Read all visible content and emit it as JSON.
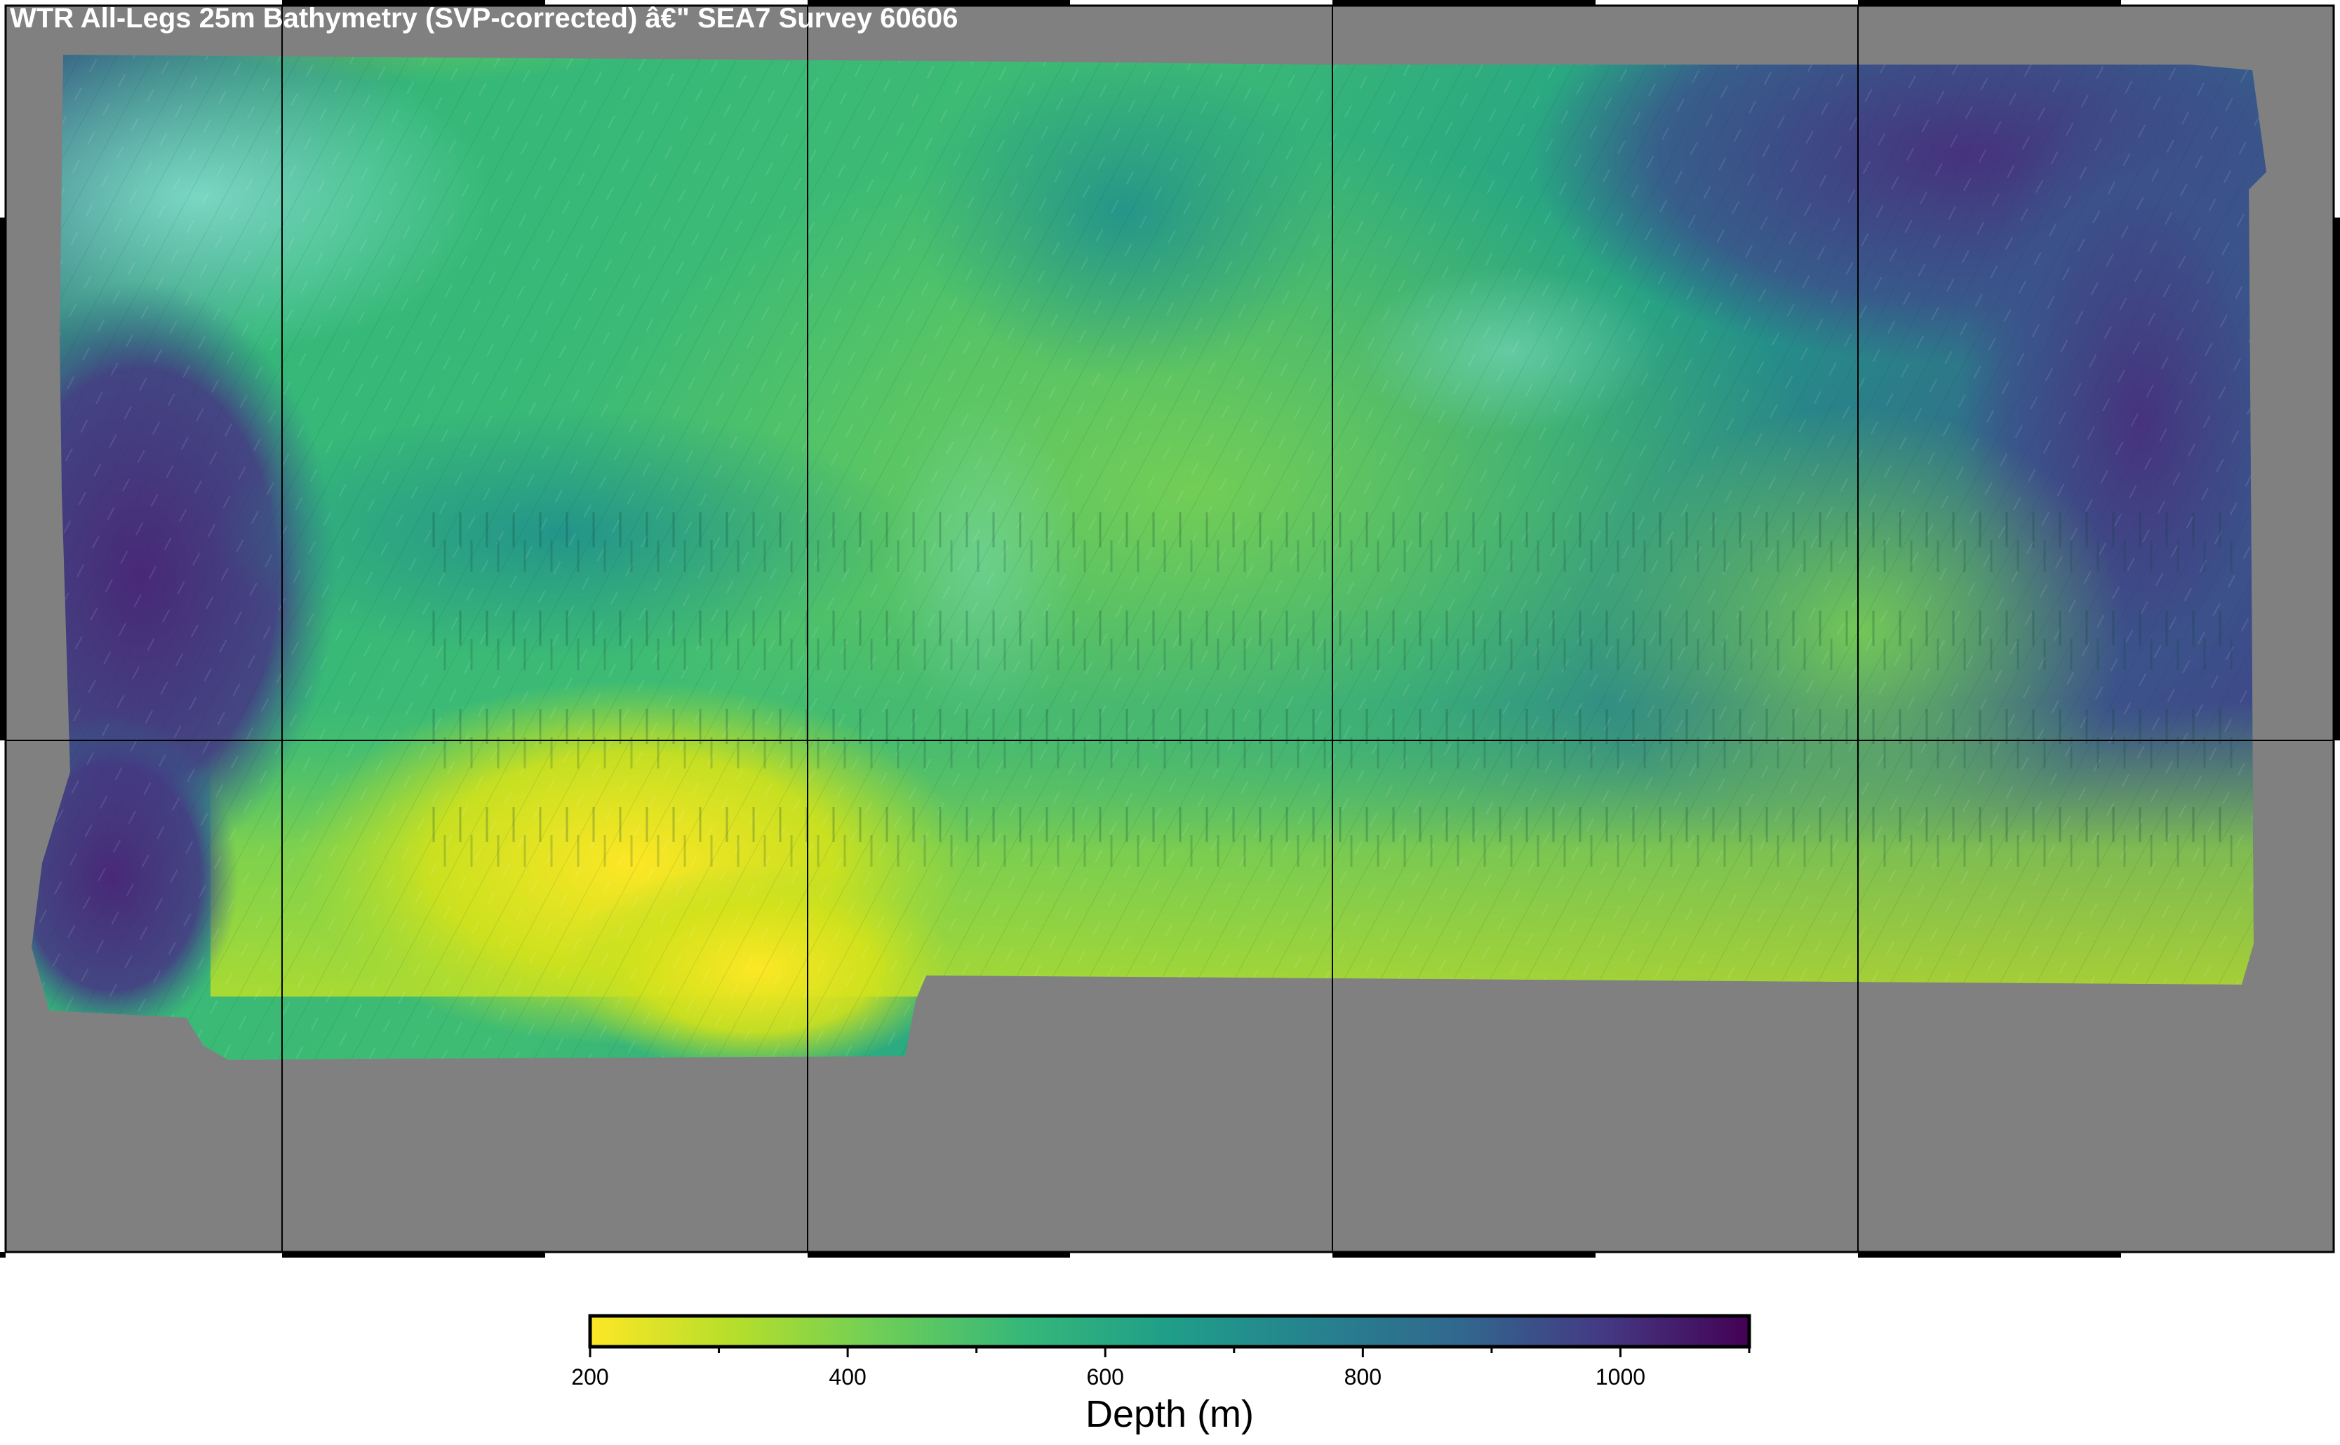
{
  "title": "WTR All-Legs 25m Bathymetry (SVP-corrected) â€\" SEA7 Survey 60606",
  "colorbar": {
    "label": "Depth (m)",
    "min": 200,
    "max": 1100,
    "colormap": "viridis-reversed",
    "ticks": [
      {
        "value": 200,
        "label": "200"
      },
      {
        "value": 400,
        "label": "400"
      },
      {
        "value": 600,
        "label": "600"
      },
      {
        "value": 800,
        "label": "800"
      },
      {
        "value": 1000,
        "label": "1000"
      }
    ],
    "minor_ticks": [
      300,
      500,
      700,
      900,
      1100
    ]
  },
  "colors": {
    "background_nodata": "#808080",
    "shallow": "#fde725",
    "mid": "#21918c",
    "deep": "#440154",
    "gridline": "#000000"
  },
  "map": {
    "grid": true,
    "frame": "checkered black/white"
  }
}
